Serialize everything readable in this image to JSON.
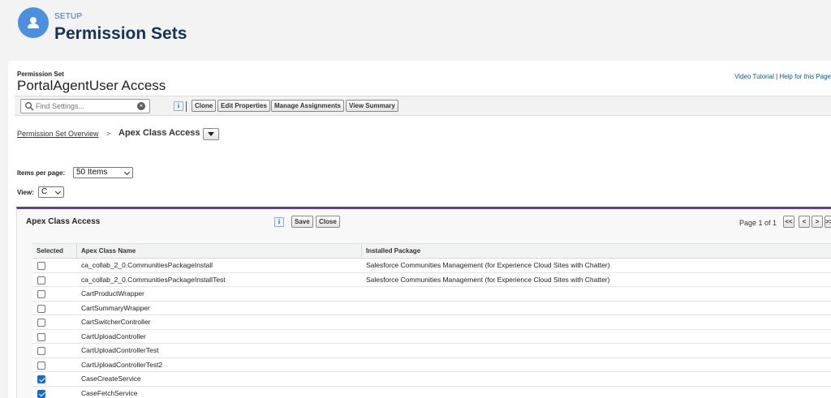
{
  "setup": {
    "kicker": "SETUP",
    "title": "Permission Sets"
  },
  "record": {
    "kicker": "Permission Set",
    "title": "PortalAgentUser Access"
  },
  "help": {
    "video": "Video Tutorial",
    "sep": "|",
    "help_page": "Help for this Page"
  },
  "toolbar": {
    "search_placeholder": "Find Settings...",
    "info_label": "i",
    "buttons": [
      "Clone",
      "Edit Properties",
      "Manage Assignments",
      "View Summary"
    ]
  },
  "breadcrumb": {
    "parent": "Permission Set Overview",
    "sep": ">",
    "current": "Apex Class Access"
  },
  "controls": {
    "items_label": "Items per page:",
    "items_value": "50 Items",
    "view_label": "View:",
    "view_value": "C"
  },
  "related_list": {
    "title": "Apex Class Access",
    "info_label": "i",
    "save_label": "Save",
    "close_label": "Close",
    "page_info": "Page 1 of 1",
    "pager": [
      "<<",
      "<",
      ">",
      ">>"
    ],
    "columns": [
      "Selected",
      "Apex Class Name",
      "Installed Package"
    ],
    "rows": [
      {
        "name": "ca_collab_2_0.CommunitiesPackageInstall",
        "package": "Salesforce Communities Management (for Experience Cloud Sites with Chatter)",
        "selected": false
      },
      {
        "name": "ca_collab_2_0.CommunitiesPackageInstallTest",
        "package": "Salesforce Communities Management (for Experience Cloud Sites with Chatter)",
        "selected": false
      },
      {
        "name": "CartProductWrapper",
        "package": "",
        "selected": false
      },
      {
        "name": "CartSummaryWrapper",
        "package": "",
        "selected": false
      },
      {
        "name": "CartSwitcherController",
        "package": "",
        "selected": false
      },
      {
        "name": "CartUploadController",
        "package": "",
        "selected": false
      },
      {
        "name": "CartUploadControllerTest",
        "package": "",
        "selected": false
      },
      {
        "name": "CartUploadControllerTest2",
        "package": "",
        "selected": false
      },
      {
        "name": "CaseCreateService",
        "package": "",
        "selected": true
      },
      {
        "name": "CaseFetchService",
        "package": "",
        "selected": true
      }
    ]
  },
  "colors": {
    "accent": "#56458c",
    "brand_blue": "#4b8fe0",
    "title_navy": "#16325c",
    "link": "#015ba7",
    "checkbox": "#0b6fd8"
  }
}
